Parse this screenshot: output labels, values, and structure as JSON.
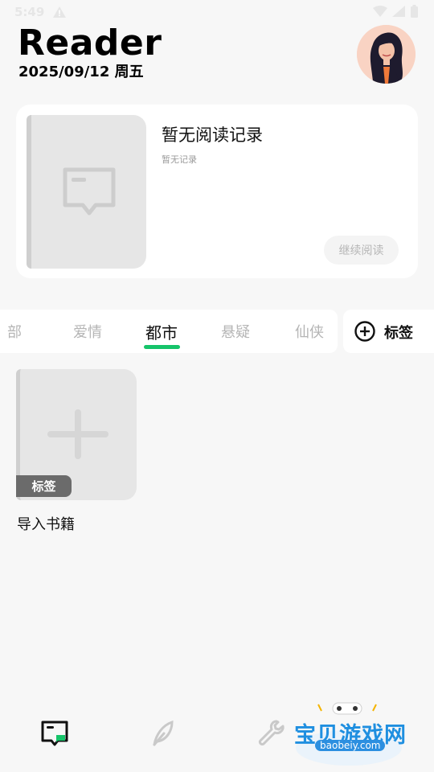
{
  "status_bar": {
    "time": "5:49"
  },
  "header": {
    "title": "Reader",
    "date": "2025/09/12 周五"
  },
  "recent": {
    "title": "暂无阅读记录",
    "subtitle": "暂无记录",
    "continue_label": "继续阅读"
  },
  "tabs": {
    "items": [
      {
        "label": "部"
      },
      {
        "label": "爱情"
      },
      {
        "label": "都市",
        "active": true
      },
      {
        "label": "悬疑"
      },
      {
        "label": "仙侠"
      }
    ],
    "add_tag_label": "标签"
  },
  "library": {
    "import_badge": "标签",
    "import_label": "导入书籍"
  },
  "bottom_nav": {
    "items": [
      {
        "icon": "bookshelf-icon",
        "active": true
      },
      {
        "icon": "feather-icon"
      },
      {
        "icon": "wrench-icon"
      }
    ]
  },
  "watermark": {
    "text": "宝贝游戏网",
    "url": "baobeiy.com"
  },
  "colors": {
    "accent": "#16c46a",
    "background": "#f7f7f7"
  }
}
